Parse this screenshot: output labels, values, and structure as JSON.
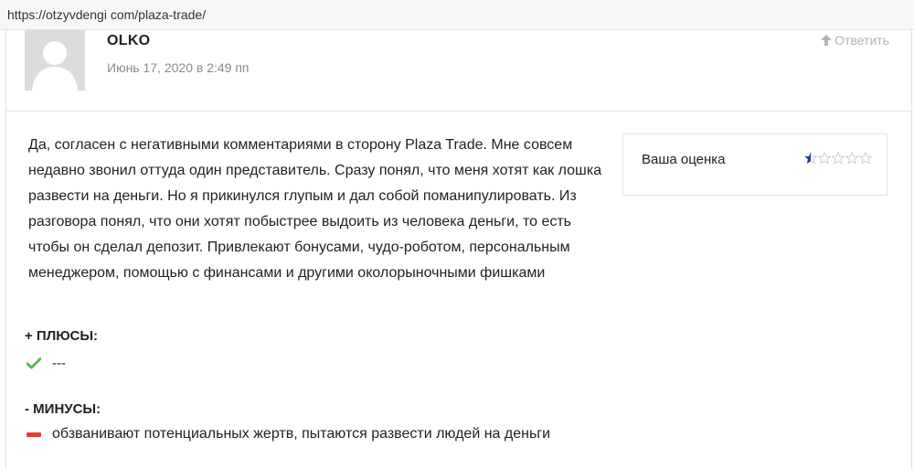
{
  "url": "https://otzyvdengi com/plaza-trade/",
  "comment": {
    "author": "OLKO",
    "date": "Июнь 17, 2020 в 2:49 пп",
    "reply_label": "Ответить",
    "text": "Да, согласен с негативными комментариями в сторону Plaza Trade. Мне совсем недавно звонил оттуда один представитель. Сразу понял, что меня хотят как лошка развести на деньги. Но я прикинулся глупым и дал собой поманипулировать. Из разговора понял, что они хотят побыстрее выдоить из человека деньги, то есть чтобы он сделал депозит. Привлекают бонусами, чудо-роботом, персональным менеджером, помощью с финансами и другими околорыночными фишками",
    "rating": {
      "label": "Ваша оценка",
      "value": 0.5,
      "max": 5,
      "star_color": "#1a3e8a",
      "empty_color": "#c8c8c8"
    },
    "pros": {
      "title": "+ ПЛЮСЫ:",
      "items": [
        "---"
      ],
      "icon": "check-icon",
      "color": "#5cb85c"
    },
    "cons": {
      "title": "- МИНУСЫ:",
      "items": [
        "обзванивают потенциальных жертв, пытаются развести людей на деньги"
      ],
      "icon": "minus-icon",
      "color": "#e53935"
    }
  }
}
